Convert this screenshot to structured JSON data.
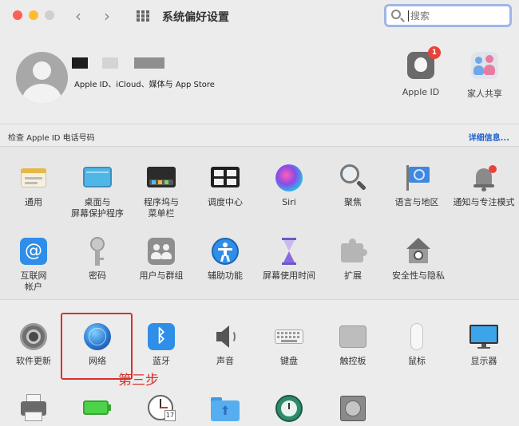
{
  "window": {
    "title": "系统偏好设置",
    "back_glyph": "‹",
    "forward_glyph": "›"
  },
  "search": {
    "placeholder": "搜索"
  },
  "account": {
    "subtitle": "Apple ID、iCloud、媒体与 App Store",
    "apple_id_label": "Apple ID",
    "apple_id_badge": "1",
    "family_label": "家人共享"
  },
  "notice": {
    "text": "检查 Apple ID 电话号码",
    "details_link": "详细信息..."
  },
  "row1": [
    "通用",
    "桌面与\n屏幕保护程序",
    "程序坞与\n菜单栏",
    "调度中心",
    "Siri",
    "聚焦",
    "语言与地区",
    "通知与专注模式"
  ],
  "row2": [
    "互联网\n帐户",
    "密码",
    "用户与群组",
    "辅助功能",
    "屏幕使用时间",
    "扩展",
    "安全性与隐私"
  ],
  "row3": [
    "软件更新",
    "网络",
    "蓝牙",
    "声音",
    "键盘",
    "触控板",
    "鼠标",
    "显示器"
  ],
  "annotation": {
    "text": "第三步"
  },
  "icons": {
    "general": "general-icon",
    "desktop": "desktop-screensaver-icon",
    "dock": "dock-menubar-icon",
    "mission": "mission-control-icon",
    "siri": "siri-icon",
    "spotlight": "spotlight-icon",
    "language": "language-region-icon",
    "notifications": "notifications-focus-icon"
  },
  "colors": {
    "accent": "#1a5fd0",
    "annotation": "#d9302b",
    "badge": "#e9423a"
  }
}
